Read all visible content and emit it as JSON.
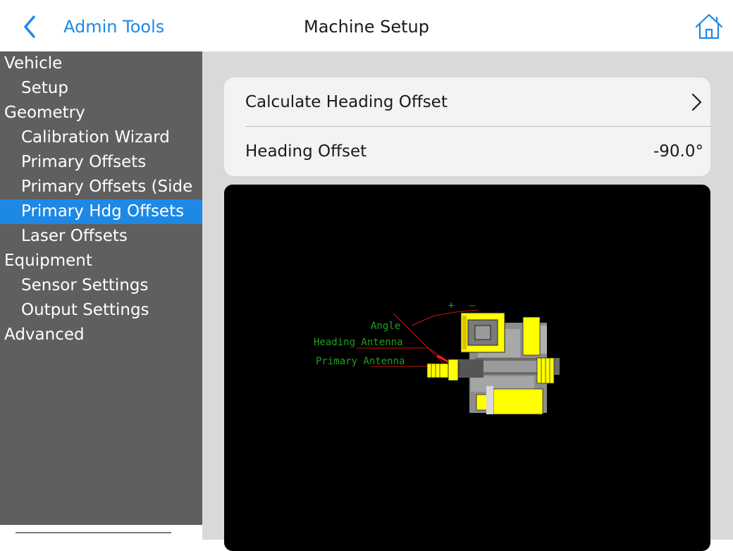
{
  "header": {
    "back_label": "Admin Tools",
    "title": "Machine Setup",
    "back_icon": "chevron-left-icon",
    "home_icon": "home-icon"
  },
  "colors": {
    "accent": "#1e88e5",
    "sidebar_bg": "#5f5f5f",
    "main_bg": "#d9d9d9",
    "diagram_label": "#1ea01e",
    "machine_yellow": "#ffff00"
  },
  "sidebar": {
    "items": [
      {
        "label": "Vehicle",
        "type": "section"
      },
      {
        "label": "Setup",
        "type": "child"
      },
      {
        "label": "Geometry",
        "type": "section"
      },
      {
        "label": "Calibration Wizard",
        "type": "child"
      },
      {
        "label": "Primary Offsets",
        "type": "child"
      },
      {
        "label": "Primary Offsets (Side",
        "type": "child"
      },
      {
        "label": "Primary Hdg Offsets",
        "type": "child",
        "active": true
      },
      {
        "label": "Laser Offsets",
        "type": "child"
      },
      {
        "label": "Equipment",
        "type": "section"
      },
      {
        "label": "Sensor Settings",
        "type": "child"
      },
      {
        "label": "Output Settings",
        "type": "child"
      },
      {
        "label": "Advanced",
        "type": "section"
      }
    ]
  },
  "settings": {
    "calculate_label": "Calculate Heading Offset",
    "heading_offset_label": "Heading Offset",
    "heading_offset_value": "-90.0°"
  },
  "diagram": {
    "angle_label": "Angle",
    "heading_antenna_label": "Heading Antenna",
    "primary_antenna_label": "Primary Antenna",
    "plus_label": "+",
    "minus_label": "—"
  }
}
